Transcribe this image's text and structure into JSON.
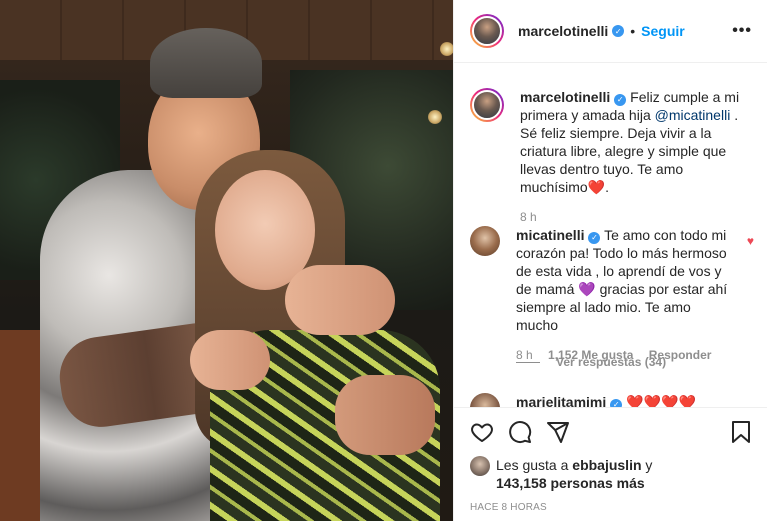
{
  "post": {
    "owner": "marcelotinelli",
    "follow_label": "Seguir",
    "more_label": "•••"
  },
  "caption": {
    "user": "marcelotinelli",
    "text_before": " Feliz cumple a mi primera y amada hija ",
    "mention": "@micatinelli",
    "text_after": " . Sé feliz siempre. Deja vivir a la criatura libre, alegre y simple que llevas dentro tuyo. Te amo muchísimo❤️.",
    "time": "8 h"
  },
  "comments": [
    {
      "user": "micatinelli",
      "text": " Te amo con todo mi corazón pa! Todo lo más hermoso de esta vida , lo aprendí de vos y de mamá 💜 gracias por estar ahí siempre al lado mio. Te amo mucho",
      "time": "8 h",
      "likes": "1,152 Me gusta",
      "reply_label": "Responder",
      "view_replies": "Ver respuestas (34)"
    },
    {
      "user": "marielitamimi",
      "text": " ❤️❤️❤️❤️"
    }
  ],
  "likes": {
    "prefix": "Les gusta a ",
    "user": "ebbajuslin",
    "and": " y",
    "count": "143,158 personas más"
  },
  "timestamp": "HACE 8 HORAS",
  "colors": {
    "accent": "#0095f6",
    "verified": "#3897f0",
    "heart": "#ed4956",
    "muted": "#8e8e8e"
  },
  "icons": [
    "heart-icon",
    "comment-icon",
    "share-icon",
    "bookmark-icon",
    "verified-badge-icon",
    "more-icon"
  ]
}
